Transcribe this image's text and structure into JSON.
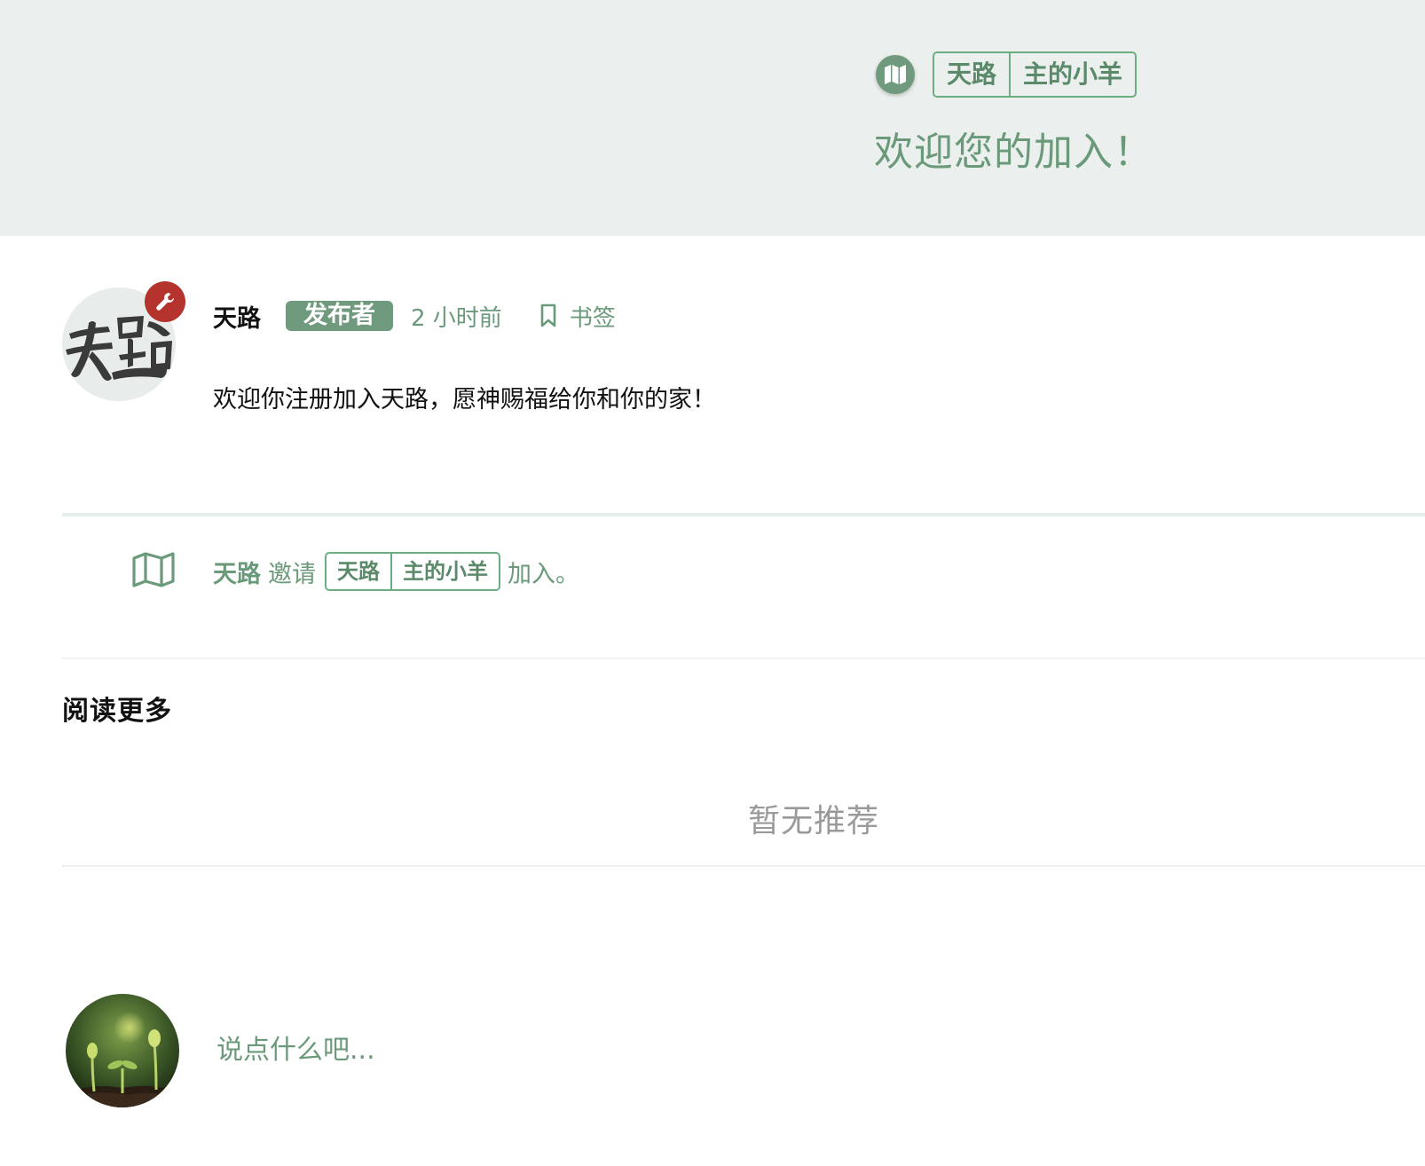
{
  "hero": {
    "icon": "map-icon",
    "tags": [
      "天路",
      "主的小羊"
    ],
    "title": "欢迎您的加入！"
  },
  "post": {
    "avatar_icon": "author-avatar",
    "admin_icon": "wrench-icon",
    "author": "天路",
    "role_badge": "发布者",
    "time": "2 小时前",
    "bookmark_icon": "bookmark-icon",
    "bookmark_label": "书签",
    "body": "欢迎你注册加入天路，愿神赐福给你和你的家！"
  },
  "event": {
    "icon": "map-outline-icon",
    "actor": "天路",
    "verb": "邀请",
    "tags": [
      "天路",
      "主的小羊"
    ],
    "suffix": "加入。"
  },
  "read_more": {
    "title": "阅读更多",
    "empty": "暂无推荐"
  },
  "comment": {
    "avatar_icon": "user-avatar",
    "placeholder": "说点什么吧..."
  },
  "colors": {
    "accent": "#6f9a7d",
    "accent_text": "#6b9a7a",
    "tag_border": "#6cae82",
    "hero_bg": "#ebf0ee",
    "admin_badge": "#b5332d",
    "muted": "#9a9a9a"
  }
}
